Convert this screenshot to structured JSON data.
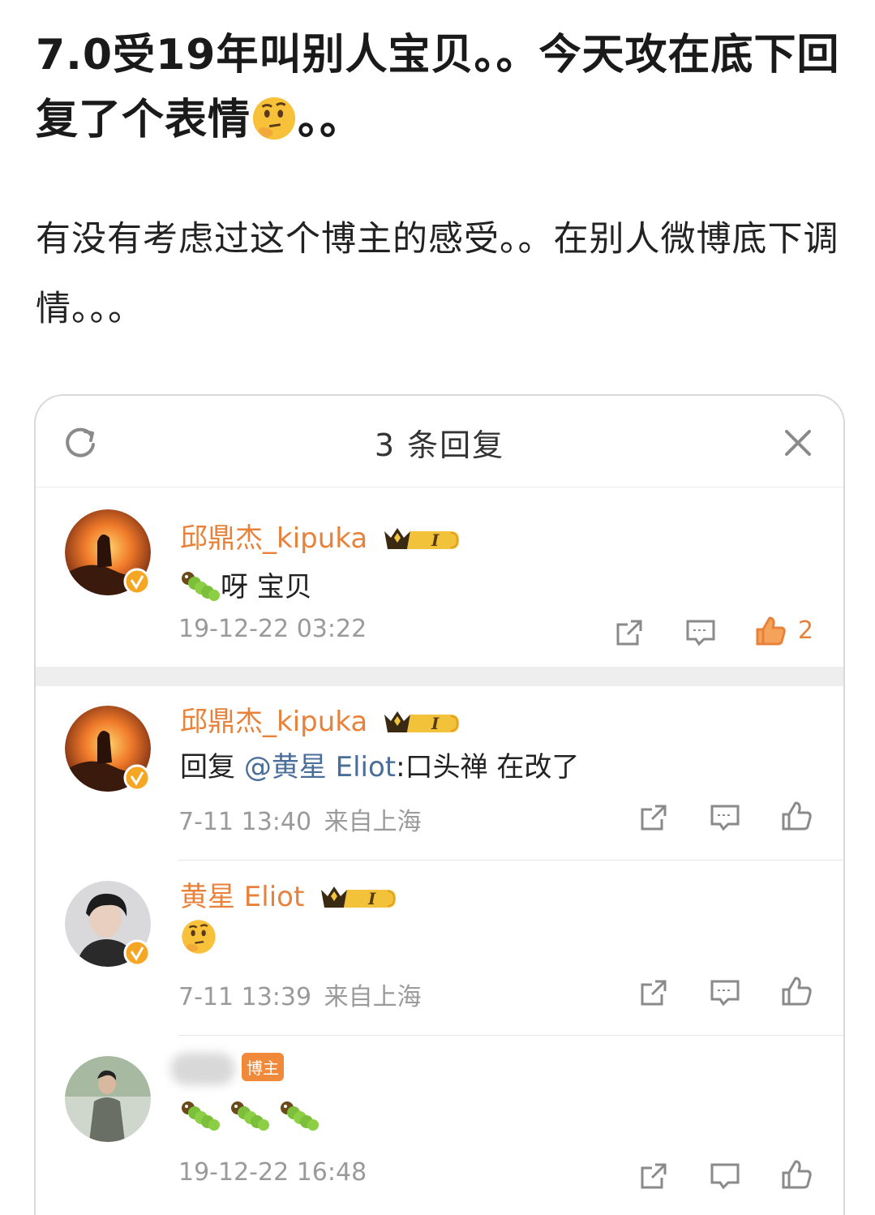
{
  "post": {
    "title_part1": "7.0受19年叫别人宝贝。。今天攻在底下回复了个表情",
    "title_part2": "。。",
    "body": "有没有考虑过这个博主的感受。。在别人微博底下调情。。。"
  },
  "panel": {
    "title": "3 条回复",
    "refresh_icon": "refresh-icon",
    "close_icon": "close-icon"
  },
  "comments": [
    {
      "username": "邱鼎杰_kipuka",
      "badge_level": "I",
      "content": "呀 宝贝",
      "emoji": "caterpillar",
      "timestamp": "19-12-22 03:22",
      "likes": "2",
      "liked": true
    },
    {
      "username": "邱鼎杰_kipuka",
      "badge_level": "I",
      "reply_prefix": "回复",
      "mention": "@黄星 Eliot",
      "content": ":口头禅 在改了",
      "timestamp": "7-11 13:40",
      "location": "来自上海"
    },
    {
      "username": "黄星 Eliot",
      "badge_level": "I",
      "emoji": "thinking-face",
      "timestamp": "7-11 13:39",
      "location": "来自上海"
    },
    {
      "author_badge": "博主",
      "emoji": "caterpillar x3",
      "timestamp": "19-12-22 16:48"
    }
  ],
  "colors": {
    "accent_orange": "#e8823a",
    "mention_blue": "#4a6d99",
    "meta_gray": "#9a9a9a"
  }
}
